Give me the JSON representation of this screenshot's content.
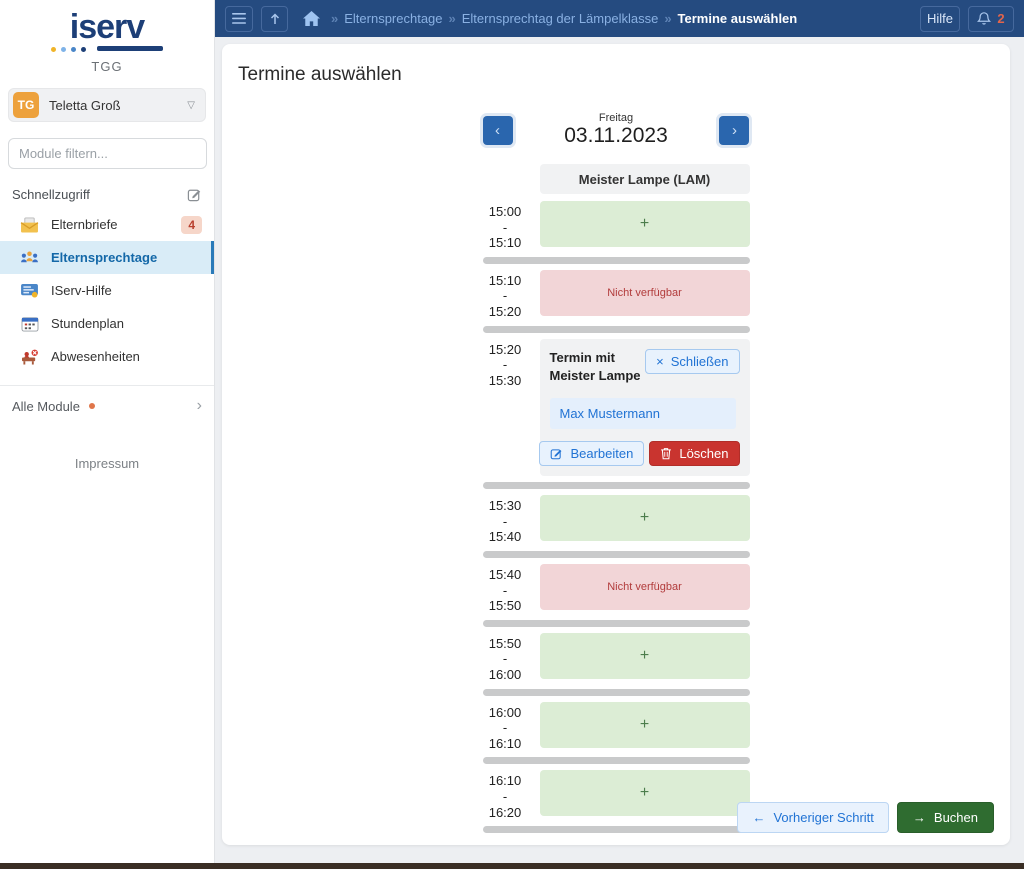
{
  "colors": {
    "navbar_bg": "#254b80",
    "primary_blue": "#2a66ae",
    "link_blue": "#2173d4",
    "available_green_bg": "#dcedd5",
    "unavailable_red_bg": "#f2d5d7",
    "unavailable_red_text": "#b23c3c",
    "delete_red": "#c9342f",
    "book_green": "#2f6c30",
    "notification_orange": "#e2654b",
    "active_item_bg": "#d9ecf7",
    "avatar_orange": "#eda13c"
  },
  "navbar": {
    "breadcrumbs": [
      {
        "label": "Elternsprechtage",
        "current": false
      },
      {
        "label": "Elternsprechtag der Lämpelklasse",
        "current": false
      },
      {
        "label": "Termine auswählen",
        "current": true
      }
    ],
    "help_label": "Hilfe",
    "notification_count": "2"
  },
  "sidebar": {
    "logo_text": "iserv",
    "school_abbr": "TGG",
    "user": {
      "initials": "TG",
      "name": "Teletta Groß"
    },
    "filter_placeholder": "Module filtern...",
    "quick_access_label": "Schnellzugriff",
    "items": [
      {
        "label": "Elternbriefe",
        "icon": "letters-icon",
        "badge": "4",
        "active": false
      },
      {
        "label": "Elternsprechtage",
        "icon": "meeting-icon",
        "active": true
      },
      {
        "label": "IServ-Hilfe",
        "icon": "help-icon",
        "active": false
      },
      {
        "label": "Stundenplan",
        "icon": "timetable-icon",
        "active": false
      },
      {
        "label": "Abwesenheiten",
        "icon": "absence-icon",
        "active": false
      }
    ],
    "all_modules_label": "Alle Module",
    "impressum_label": "Impressum"
  },
  "main": {
    "title": "Termine auswählen",
    "date_nav": {
      "weekday": "Freitag",
      "date": "03.11.2023"
    },
    "column_header": "Meister Lampe (LAM)",
    "slots": [
      {
        "start": "15:00",
        "end": "15:10",
        "status": "available"
      },
      {
        "start": "15:10",
        "end": "15:20",
        "status": "unavailable",
        "label": "Nicht verfügbar"
      },
      {
        "start": "15:20",
        "end": "15:30",
        "status": "booked",
        "booked": {
          "title": "Termin mit\nMeister Lampe",
          "close_label": "Schließen",
          "student": "Max Mustermann",
          "edit_label": "Bearbeiten",
          "delete_label": "Löschen"
        }
      },
      {
        "start": "15:30",
        "end": "15:40",
        "status": "available"
      },
      {
        "start": "15:40",
        "end": "15:50",
        "status": "unavailable",
        "label": "Nicht verfügbar"
      },
      {
        "start": "15:50",
        "end": "16:00",
        "status": "available"
      },
      {
        "start": "16:00",
        "end": "16:10",
        "status": "available"
      },
      {
        "start": "16:10",
        "end": "16:20",
        "status": "available"
      }
    ],
    "footer": {
      "previous_label": "Vorheriger Schritt",
      "book_label": "Buchen"
    }
  }
}
